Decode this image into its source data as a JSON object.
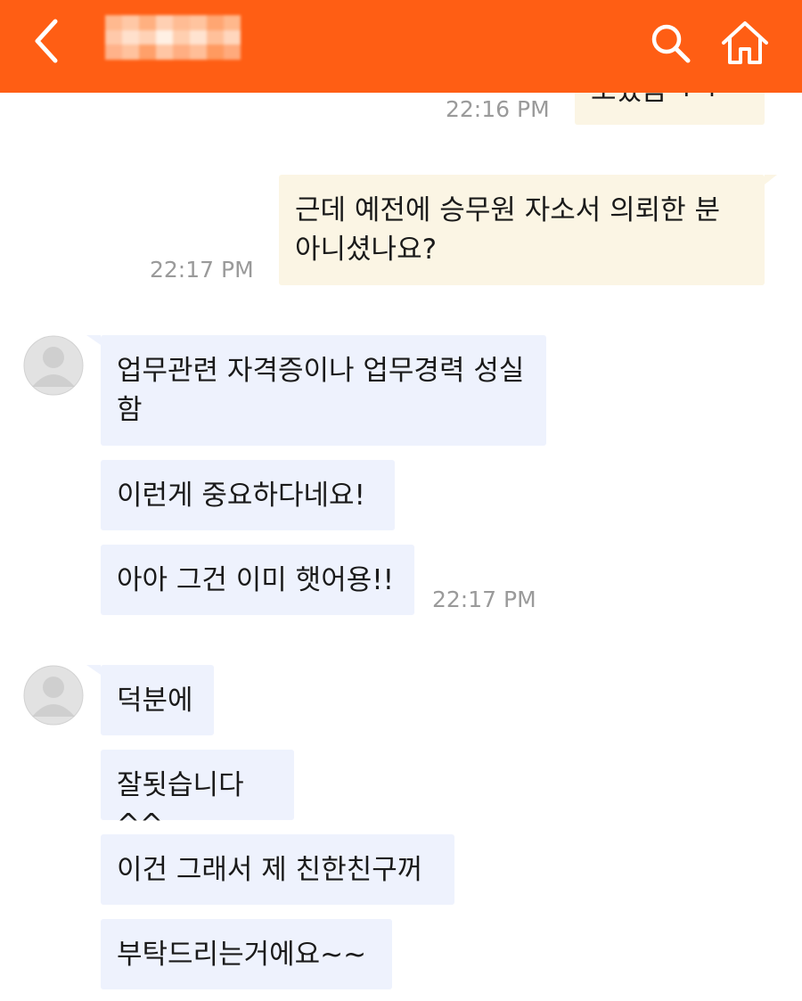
{
  "header": {
    "back_icon": "chevron-left-icon",
    "title_redacted": true,
    "search_icon": "search-icon",
    "home_icon": "home-icon",
    "accent_color": "#ff5e14"
  },
  "messages": [
    {
      "side": "mine",
      "text": "모였음ㅋㅋ",
      "time": "22:16 PM",
      "partial": true
    },
    {
      "side": "mine",
      "text": "근데 예전에 승무원 자소서 의뢰한 분 아니셨나요?",
      "time": "22:17 PM"
    },
    {
      "side": "theirs",
      "text": "업무관련 자격증이나 업무경력 성실함"
    },
    {
      "side": "theirs",
      "text": "이런게 중요하다네요!"
    },
    {
      "side": "theirs",
      "text": "아아 그건 이미 햇어용!!",
      "time": "22:17 PM"
    },
    {
      "side": "theirs",
      "text": "덕분에"
    },
    {
      "side": "theirs",
      "text": "잘됫습니다^^"
    },
    {
      "side": "theirs",
      "text": "이건 그래서 제 친한친구꺼"
    },
    {
      "side": "theirs",
      "text": "부탁드리는거에요~~"
    }
  ],
  "colors": {
    "my_bubble": "#fbf5e4",
    "their_bubble": "#eef2fd",
    "timestamp": "#9a9a9a"
  }
}
